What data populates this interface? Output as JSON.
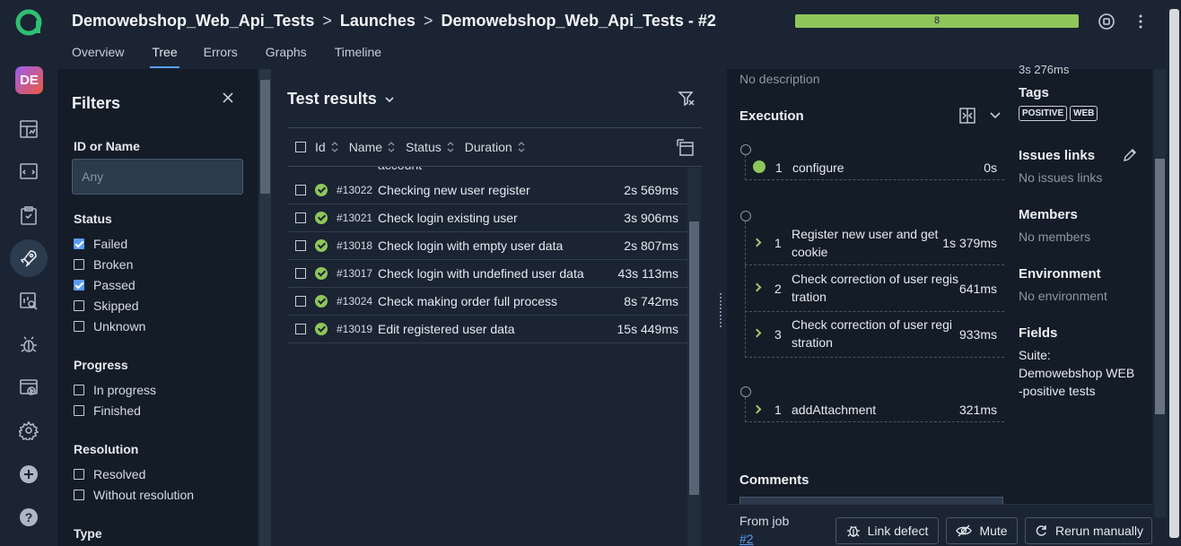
{
  "rail": {
    "avatar": "DE",
    "icons": [
      "dashboards-icon",
      "test-cases-icon",
      "test-plans-icon",
      "launches-icon",
      "analytics-icon",
      "defects-icon",
      "jobs-icon",
      "settings-icon",
      "add-icon",
      "help-icon"
    ]
  },
  "breadcrumbs": [
    "Demowebshop_Web_Api_Tests",
    "Launches",
    "Demowebshop_Web_Api_Tests - #2"
  ],
  "progress_label": "8",
  "progress_value": 1.0,
  "tabs": [
    "Overview",
    "Tree",
    "Errors",
    "Graphs",
    "Timeline"
  ],
  "active_tab": "Tree",
  "filters": {
    "title": "Filters",
    "id_label": "ID or Name",
    "id_placeholder": "Any",
    "status_label": "Status",
    "status": [
      {
        "label": "Failed",
        "checked": true
      },
      {
        "label": "Broken",
        "checked": false
      },
      {
        "label": "Passed",
        "checked": true
      },
      {
        "label": "Skipped",
        "checked": false
      },
      {
        "label": "Unknown",
        "checked": false
      }
    ],
    "progress_label": "Progress",
    "progress": [
      {
        "label": "In progress",
        "checked": false
      },
      {
        "label": "Finished",
        "checked": false
      }
    ],
    "resolution_label": "Resolution",
    "resolution": [
      {
        "label": "Resolved",
        "checked": false
      },
      {
        "label": "Without resolution",
        "checked": false
      }
    ],
    "type_label": "Type"
  },
  "results": {
    "title": "Test results",
    "columns": [
      "Id",
      "Name",
      "Status",
      "Duration"
    ],
    "partial_row": "account",
    "rows": [
      {
        "id": "#13022",
        "name": "Checking new user register",
        "duration": "2s 569ms"
      },
      {
        "id": "#13021",
        "name": "Check login existing user",
        "duration": "3s 906ms"
      },
      {
        "id": "#13018",
        "name": "Check login with empty user data",
        "duration": "2s 807ms"
      },
      {
        "id": "#13017",
        "name": "Check login with undefined user data",
        "duration": "43s 113ms"
      },
      {
        "id": "#13024",
        "name": "Check making order full process",
        "duration": "8s 742ms"
      },
      {
        "id": "#13019",
        "name": "Edit registered user data",
        "duration": "15s 449ms"
      }
    ]
  },
  "details": {
    "description": "No description",
    "execution_title": "Execution",
    "setup": [
      {
        "num": "1",
        "name": "configure",
        "duration": "0s"
      }
    ],
    "body": [
      {
        "num": "1",
        "name": "Register new user and get cookie",
        "line1": "Register new user and get",
        "line2": "cookie",
        "duration": "1s 379ms"
      },
      {
        "num": "2",
        "name": "Check correction of user registration",
        "line1": "Check correction of user regis",
        "line2": "tration",
        "duration": "641ms"
      },
      {
        "num": "3",
        "name": "Check correction of user registration",
        "line1": "Check correction of user regi",
        "line2": "stration",
        "duration": "933ms"
      }
    ],
    "teardown": [
      {
        "num": "1",
        "name": "addAttachment",
        "duration": "321ms"
      }
    ],
    "comments_title": "Comments",
    "from_job_label": "From job",
    "from_job_link": "#2",
    "side": {
      "duration_partial": "3s 276ms",
      "tags_title": "Tags",
      "tags": [
        "POSITIVE",
        "WEB"
      ],
      "issues_title": "Issues links",
      "issues_value": "No issues links",
      "members_title": "Members",
      "members_value": "No members",
      "environment_title": "Environment",
      "environment_value": "No environment",
      "fields_title": "Fields",
      "fields_line1": "Suite:",
      "fields_line2": "Demowebshop WEB",
      "fields_line3": "-positive tests"
    },
    "buttons": {
      "link_defect": "Link defect",
      "mute": "Mute",
      "rerun": "Rerun manually"
    }
  },
  "colors": {
    "accent": "#5b9df5",
    "passed": "#8fc65a",
    "logo": "#2fbf71",
    "bg": "#1b2433",
    "panel": "#141c28"
  }
}
